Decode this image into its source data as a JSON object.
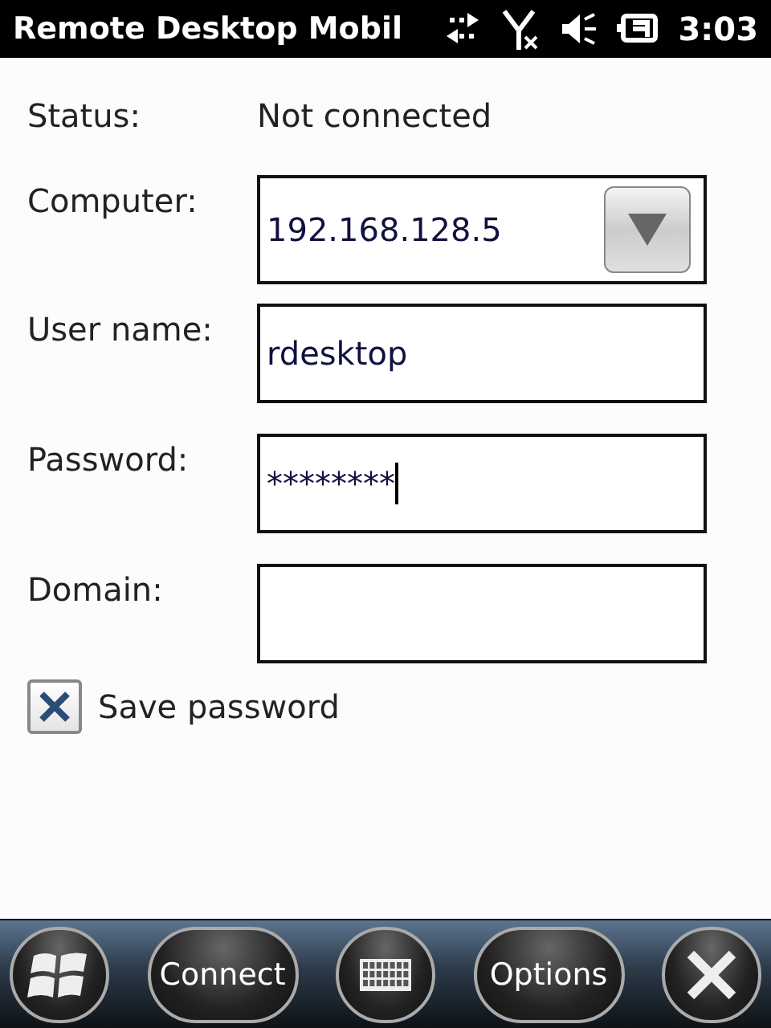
{
  "status_bar": {
    "title": "Remote Desktop Mobil",
    "time": "3:03"
  },
  "form": [
    {
      "kind": "static",
      "label": "Status:",
      "value": "Not connected"
    },
    {
      "kind": "dropdown",
      "label": "Computer:",
      "value": "192.168.128.5"
    },
    {
      "kind": "text",
      "label": "User name:",
      "value": "rdesktop",
      "focused": false
    },
    {
      "kind": "text",
      "label": "Password:",
      "value": "********",
      "focused": true
    },
    {
      "kind": "text",
      "label": "Domain:",
      "focused": false
    }
  ],
  "save_password": {
    "label": "Save password",
    "checked": true
  },
  "softkeys": [
    {
      "kind": "start"
    },
    {
      "kind": "text",
      "label": "Connect"
    },
    {
      "kind": "keyboard"
    },
    {
      "kind": "text",
      "label": "Options"
    },
    {
      "kind": "close"
    }
  ]
}
